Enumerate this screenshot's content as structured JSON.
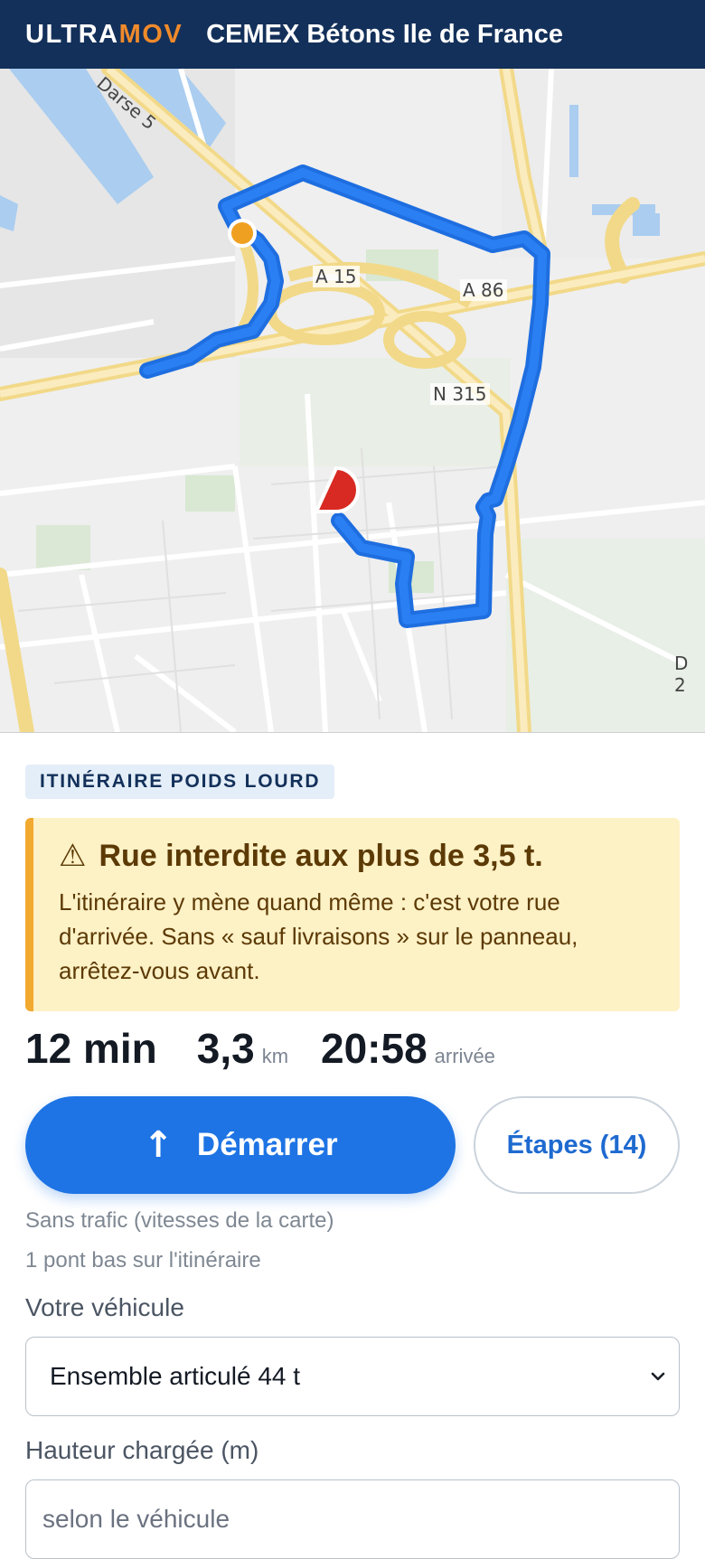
{
  "header": {
    "brand_part1": "ULTRA",
    "brand_part2": "MOV",
    "organization": "CEMEX Bétons Ile de France",
    "colors": {
      "background": "#13305a",
      "brand_accent": "#f08a2b"
    }
  },
  "map": {
    "labels": {
      "canal": "Darse 5",
      "a15": "A 15",
      "a86": "A 86",
      "n315": "N 315",
      "d2": "D 2"
    },
    "route_color": "#1e6ee0",
    "origin_marker_color": "#f0a020",
    "destination_marker_color": "#d82a22"
  },
  "panel": {
    "tag": "ITINÉRAIRE POIDS LOURD",
    "alert": {
      "icon": "warning-icon",
      "title": "Rue interdite aux plus de 3,5 t.",
      "body": "L'itinéraire y mène quand même : c'est votre rue d'arrivée. Sans « sauf livraisons » sur le panneau, arrêtez-vous avant."
    },
    "stats": {
      "duration": "12 min",
      "distance_value": "3,3",
      "distance_unit": "km",
      "arrival_time": "20:58",
      "arrival_label": "arrivée"
    },
    "start_button": {
      "icon": "arrow-up-icon",
      "label": "Démarrer"
    },
    "steps_button": {
      "label": "Étapes (14)"
    },
    "traffic_note": "Sans trafic (vitesses de la carte)",
    "bridge_note": "1 pont bas sur l'itinéraire",
    "vehicle": {
      "label": "Votre véhicule",
      "selected": "Ensemble articulé 44 t"
    },
    "height": {
      "label": "Hauteur chargée (m)",
      "placeholder": "selon le véhicule"
    }
  }
}
